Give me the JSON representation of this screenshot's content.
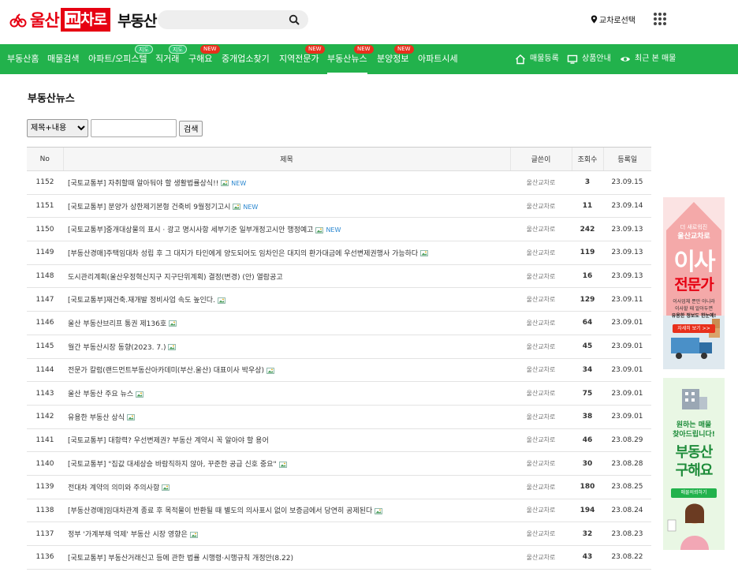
{
  "header": {
    "logo_part1": "울산",
    "logo_box_a": "교",
    "logo_box_b": "차",
    "logo_box_c": "로",
    "logo_part2": "부동산",
    "search_placeholder": "",
    "location_label": "교차로선택"
  },
  "nav": {
    "items": [
      {
        "label": "부동산홈"
      },
      {
        "label": "매물검색"
      },
      {
        "label": "아파트/오피스텔",
        "badge": "지도"
      },
      {
        "label": "직거래",
        "badge": "지도"
      },
      {
        "label": "구해요",
        "badge": "NEW"
      },
      {
        "label": "중개업소찾기"
      },
      {
        "label": "지역전문가",
        "badge": "NEW"
      },
      {
        "label": "부동산뉴스",
        "badge": "NEW"
      },
      {
        "label": "분양정보",
        "badge": "NEW"
      },
      {
        "label": "아파트시세"
      }
    ],
    "right": [
      {
        "label": "매물등록",
        "icon": "home-icon"
      },
      {
        "label": "상품안내",
        "icon": "monitor-icon"
      },
      {
        "label": "최근 본 매물",
        "icon": "eye-icon"
      }
    ]
  },
  "main": {
    "title": "부동산뉴스",
    "filter": {
      "select_value": "제목+내용",
      "input_value": "",
      "button_label": "검색"
    },
    "table": {
      "headers": [
        "No",
        "제목",
        "글쓴이",
        "조회수",
        "등록일"
      ],
      "rows": [
        {
          "no": "1152",
          "title": "[국토교통부] 자취할때 알아둬야 할 생활법률상식!!",
          "new": true,
          "author": "울산교차로",
          "views": "3",
          "date": "23.09.15"
        },
        {
          "no": "1151",
          "title": "[국토교통부] 분양가 상한제기본형 건축비 9월정기고시",
          "new": true,
          "author": "울산교차로",
          "views": "11",
          "date": "23.09.14"
        },
        {
          "no": "1150",
          "title": "[국토교통부]중개대상물의 표시 · 광고 명시사항 세부기준 일부개정고시안 행정예고",
          "new": true,
          "author": "울산교차로",
          "views": "242",
          "date": "23.09.13"
        },
        {
          "no": "1149",
          "title": "[부동산경매]주택임대차 성립 후 그 대지가 타인에게 양도되어도 임차인은 대지의 환가대금에 우선변제권행사 가능하다",
          "new": false,
          "author": "울산교차로",
          "views": "119",
          "date": "23.09.13"
        },
        {
          "no": "1148",
          "title": "도시관리계획(울산우정혁신지구 지구단위계획) 결정(변경) (안) 열람공고",
          "new": false,
          "noimg": true,
          "author": "울산교차로",
          "views": "16",
          "date": "23.09.13"
        },
        {
          "no": "1147",
          "title": "[국토교통부]재건축.재개발 정비사업 속도 높인다.",
          "new": false,
          "author": "울산교차로",
          "views": "129",
          "date": "23.09.11"
        },
        {
          "no": "1146",
          "title": "울산 부동산브리프 통권 제136호",
          "new": false,
          "author": "울산교차로",
          "views": "64",
          "date": "23.09.01"
        },
        {
          "no": "1145",
          "title": "월간 부동산시장 동향(2023. 7.)",
          "new": false,
          "author": "울산교차로",
          "views": "45",
          "date": "23.09.01"
        },
        {
          "no": "1144",
          "title": "전문가 칼럼(랜드먼트부동산아카데미(부산.울산) 대표이사 박우상)",
          "new": false,
          "author": "울산교차로",
          "views": "34",
          "date": "23.09.01"
        },
        {
          "no": "1143",
          "title": "울산 부동산 주요 뉴스",
          "new": false,
          "author": "울산교차로",
          "views": "75",
          "date": "23.09.01"
        },
        {
          "no": "1142",
          "title": "유용한 부동산 상식",
          "new": false,
          "author": "울산교차로",
          "views": "38",
          "date": "23.09.01"
        },
        {
          "no": "1141",
          "title": "[국토교통부] 대항력? 우선변제권? 부동산 계약시 꼭 알아야 할 용어",
          "new": false,
          "noimg": true,
          "author": "울산교차로",
          "views": "46",
          "date": "23.08.29"
        },
        {
          "no": "1140",
          "title": "[국토교통부] \"집값 대세상승 바람직하지 않아, 꾸준한 공급 신호 중요\"",
          "new": false,
          "author": "울산교차로",
          "views": "30",
          "date": "23.08.28"
        },
        {
          "no": "1139",
          "title": "전대차 계약의 의미와 주의사항",
          "new": false,
          "author": "울산교차로",
          "views": "180",
          "date": "23.08.25"
        },
        {
          "no": "1138",
          "title": "[부동산경매]임대차관계 종료 후 목적물이 반환될 때 별도의 의사표시 없이 보증금에서 당연히 공제된다",
          "new": false,
          "author": "울산교차로",
          "views": "194",
          "date": "23.08.24"
        },
        {
          "no": "1137",
          "title": "정부 '가계부채 억제' 부동산 시장 영향은",
          "new": false,
          "author": "울산교차로",
          "views": "32",
          "date": "23.08.23"
        },
        {
          "no": "1136",
          "title": "[국토교통부] 부동산거래신고 등에 관한 법률 시행령·시행규칙 개정안(8.22)",
          "new": false,
          "noimg": true,
          "author": "울산교차로",
          "views": "43",
          "date": "23.08.22"
        }
      ]
    }
  },
  "banners": {
    "moving": {
      "top_label": "더 새로워진",
      "brand": "울산교차로",
      "big1": "이사",
      "big2": "전문가",
      "desc1": "이사업체 뿐만 아니라",
      "desc2": "이사할 때 알아두면",
      "desc3": "유용한 정보도 한눈에!",
      "button": "자세히 보기 >>"
    },
    "wanted": {
      "desc1": "원하는 매물",
      "desc2": "찾아드립니다!",
      "big1": "부동산",
      "big2": "구해요",
      "button": "매물의뢰하기"
    }
  },
  "colors": {
    "brand_red": "#e60012",
    "nav_green": "#22b24c",
    "new_badge": "#e8301c",
    "new_text": "#2a87d0"
  }
}
